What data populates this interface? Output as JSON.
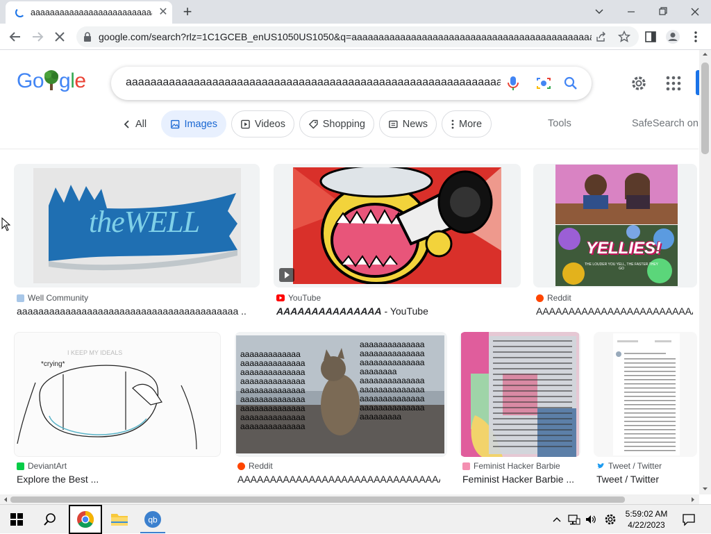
{
  "browser": {
    "tab_title": "aaaaaaaaaaaaaaaaaaaaaaaaaaaaaa",
    "url": "google.com/search?rlz=1C1GCEB_enUS1050US1050&q=aaaaaaaaaaaaaaaaaaaaaaaaaaaaaaaaaaaaaaaaaaaaaaaa..."
  },
  "search": {
    "query": "aaaaaaaaaaaaaaaaaaaaaaaaaaaaaaaaaaaaaaaaaaaaaaaaaaaaaaaaaaaaaaaa!!!!"
  },
  "chips": {
    "all": "All",
    "images": "Images",
    "videos": "Videos",
    "shopping": "Shopping",
    "news": "News",
    "more": "More",
    "tools": "Tools",
    "safesearch": "SafeSearch on"
  },
  "results": [
    {
      "source": "Well Community",
      "title": "aaaaaaaaaaaaaaaaaaaaaaaaaaaaaaaaaaaaaaaaa ...",
      "thumb_text": "theWELL"
    },
    {
      "source": "YouTube",
      "title_bold": "AAAAAAAAAAAAAAA",
      "title_rest": " - YouTube"
    },
    {
      "source": "Reddit",
      "title": "AAAAAAAAAAAAAAAAAAAAAAAAAAAAAAAAAAAAAAAAA...",
      "thumb_text": "YELLIES!",
      "thumb_sub": "THE LOUDER YOU YELL, THE FASTER THEY GO"
    },
    {
      "source": "DeviantArt",
      "title": "Explore the Best ...",
      "thumb_text": "I KEEP MY IDEALS",
      "thumb_sub": "*crying*"
    },
    {
      "source": "Reddit",
      "title": "AAAAAAAAAAAAAAAAAAAAAAAAAAAAAAAAAAAA...",
      "cat_left": "aaaaaaaaaaaaa\naaaaaaaaaaaaaa\naaaaaaaaaaaaaa\naaaaaaaaaaaaaa\naaaaaaaaaaaaaa\naaaaaaaaaaaaaa\naaaaaaaaaaaaaa\naaaaaaaaaaaaaa\naaaaaaaaaaaaaa",
      "cat_right": "aaaaaaaaaaaaaa\naaaaaaaaaaaaaa\naaaaaaaaaaaaaa\naaaaaaaa\naaaaaaaaaaaaaa\naaaaaaaaaaaaaa\naaaaaaaaaaaaaa\naaaaaaaaaaaaaa\naaaaaaaaa"
    },
    {
      "source": "Feminist Hacker Barbie",
      "title": "Feminist Hacker Barbie ..."
    },
    {
      "source": "Tweet / Twitter",
      "title": "Tweet / Twitter"
    }
  ],
  "taskbar": {
    "time": "5:59:02 AM",
    "date": "4/22/2023"
  },
  "colors": {
    "google_blue": "#4285f4",
    "google_red": "#ea4335",
    "google_yellow": "#fbbc05",
    "google_green": "#34a853",
    "chip_selected_bg": "#e8f0fe",
    "chip_selected_text": "#1967d2"
  }
}
